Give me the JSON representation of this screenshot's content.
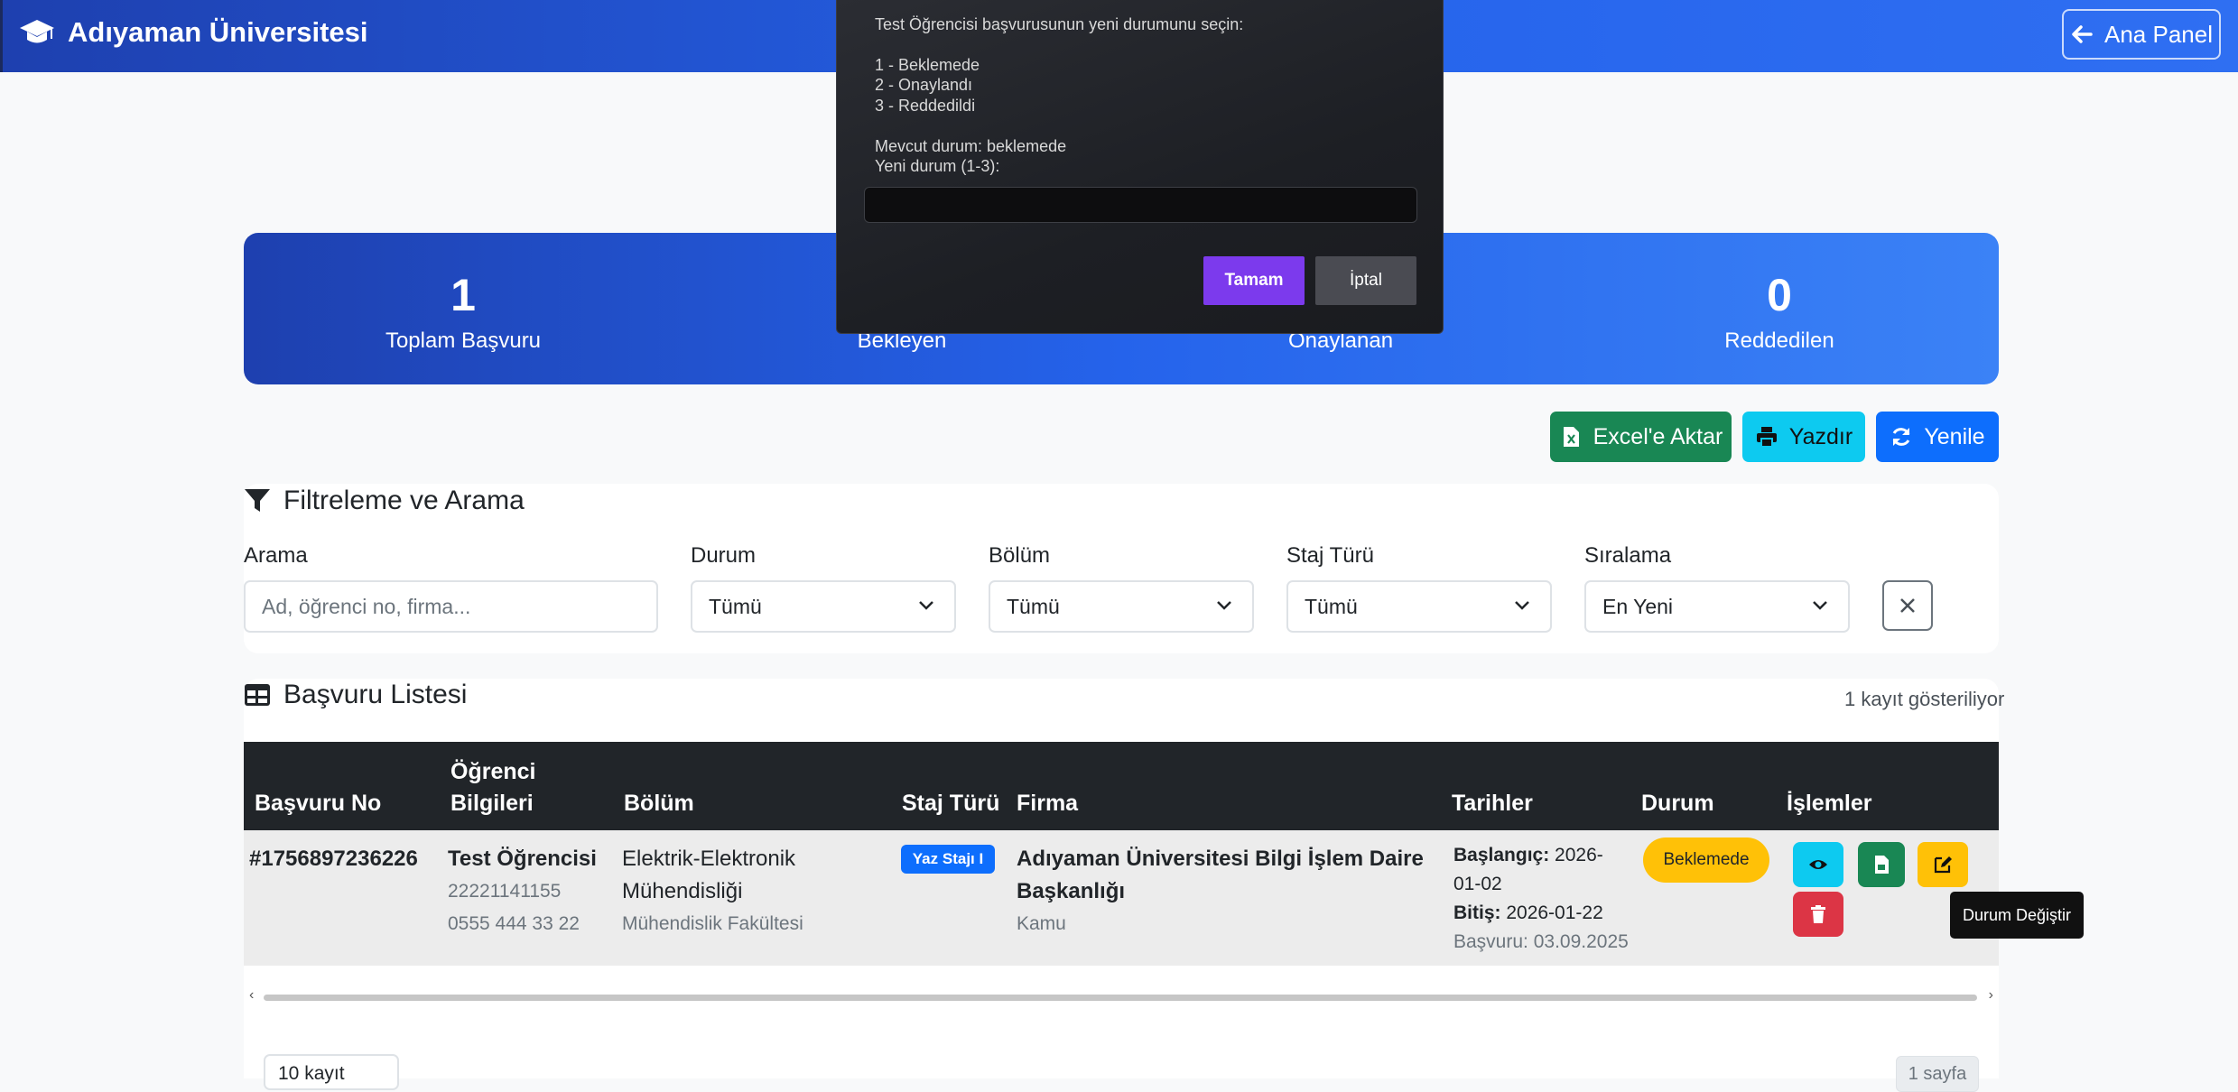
{
  "navbar": {
    "brand": "Adıyaman Üniversitesi",
    "back_button": "Ana Panel"
  },
  "stats": [
    {
      "value": "1",
      "label": "Toplam Başvuru"
    },
    {
      "value": "",
      "label": "Bekleyen"
    },
    {
      "value": "",
      "label": "Onaylanan"
    },
    {
      "value": "0",
      "label": "Reddedilen"
    }
  ],
  "actions": {
    "excel": "Excel'e Aktar",
    "print": "Yazdır",
    "refresh": "Yenile"
  },
  "filters": {
    "title": "Filtreleme ve Arama",
    "search_label": "Arama",
    "search_placeholder": "Ad, öğrenci no, firma...",
    "status_label": "Durum",
    "status_value": "Tümü",
    "dept_label": "Bölüm",
    "dept_value": "Tümü",
    "type_label": "Staj Türü",
    "type_value": "Tümü",
    "sort_label": "Sıralama",
    "sort_value": "En Yeni"
  },
  "list": {
    "title": "Başvuru Listesi",
    "count": "1 kayıt gösteriliyor",
    "headers": {
      "no": "Başvuru No",
      "student_1": "Öğrenci",
      "student_2": "Bilgileri",
      "dept": "Bölüm",
      "type": "Staj Türü",
      "company": "Firma",
      "dates": "Tarihler",
      "status": "Durum",
      "actions": "İşlemler"
    },
    "row": {
      "no": "#1756897236226",
      "name": "Test Öğrencisi",
      "student_no": "22221141155",
      "phone": "0555 444 33 22",
      "dept_1": "Elektrik-Elektronik",
      "dept_2": "Mühendisliği",
      "faculty": "Mühendislik Fakültesi",
      "type": "Yaz Stajı I",
      "company_1": "Adıyaman Üniversitesi Bilgi İşlem Daire",
      "company_2": "Başkanlığı",
      "company_type": "Kamu",
      "start_label": "Başlangıç:",
      "start_1": " 2026-",
      "start_2": "01-02",
      "end_label": "Bitiş:",
      "end": " 2026-01-22",
      "applied": "Başvuru: 03.09.2025",
      "status": "Beklemede"
    },
    "tooltip": "Durum Değiştir",
    "page_size": "10 kayıt",
    "page_info": "1 sayfa"
  },
  "dialog": {
    "line1": "Test Öğrencisi başvurusunun yeni durumunu seçin:",
    "opt1": "1 - Beklemede",
    "opt2": "2 - Onaylandı",
    "opt3": "3 - Reddedildi",
    "current": "Mevcut durum: beklemede",
    "prompt": "Yeni durum (1-3):",
    "input_value": "",
    "ok": "Tamam",
    "cancel": "İptal"
  },
  "colors": {
    "primary": "#2563eb",
    "success": "#198754",
    "info": "#0dcaf0",
    "warning": "#ffc107",
    "danger": "#dc3545",
    "dialog_ok": "#7c3aed"
  }
}
